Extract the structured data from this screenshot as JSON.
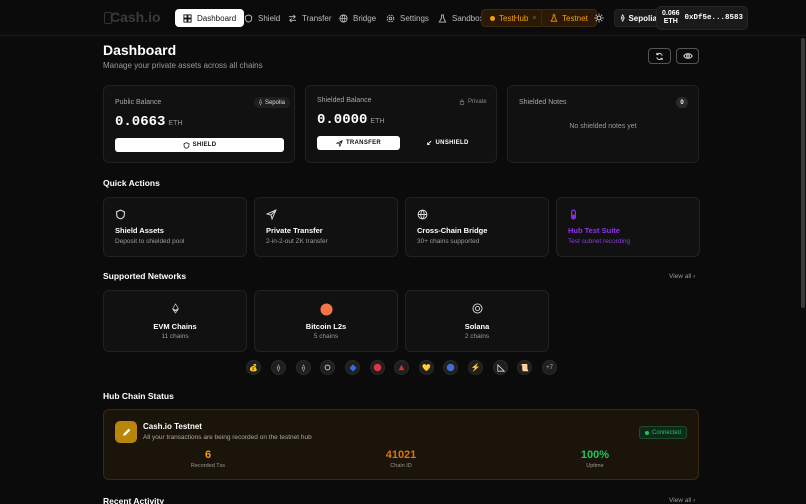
{
  "nav": {
    "brand": "Cash.io",
    "items": [
      "Dashboard",
      "Shield",
      "Transfer",
      "Bridge",
      "Settings",
      "Sandbox"
    ],
    "testhub": "TestHub",
    "testnet": "Testnet",
    "network": "Sepolia",
    "wallet_balance": "0.066",
    "wallet_unit": "ETH",
    "wallet_address": "0xDf5e...8583"
  },
  "header": {
    "title": "Dashboard",
    "subtitle": "Manage your private assets across all chains"
  },
  "public_balance": {
    "label": "Public Balance",
    "chip": "Sepolia",
    "value": "0.0663",
    "unit": "ETH",
    "button": "SHIELD"
  },
  "shielded_balance": {
    "label": "Shielded Balance",
    "chip": "Private",
    "value": "0.0000",
    "unit": "ETH",
    "transfer": "TRANSFER",
    "unshield": "UNSHIELD"
  },
  "shielded_notes": {
    "label": "Shielded Notes",
    "count": "0",
    "empty": "No shielded notes yet"
  },
  "quick_actions": {
    "title": "Quick Actions",
    "items": [
      {
        "title": "Shield Assets",
        "sub": "Deposit to shielded pool"
      },
      {
        "title": "Private Transfer",
        "sub": "2-in-2-out ZK transfer"
      },
      {
        "title": "Cross-Chain Bridge",
        "sub": "30+ chains supported"
      },
      {
        "title": "Hub Test Suite",
        "sub": "Test subnet recording"
      }
    ]
  },
  "networks": {
    "title": "Supported Networks",
    "view_all": "View all",
    "items": [
      {
        "name": "EVM Chains",
        "count": "11 chains"
      },
      {
        "name": "Bitcoin L2s",
        "count": "5 chains"
      },
      {
        "name": "Solana",
        "count": "2 chains"
      }
    ],
    "more": "+7"
  },
  "hub": {
    "title": "Hub Chain Status",
    "name": "Cash.io Testnet",
    "sub": "All your transactions are being recorded on the testnet hub",
    "status": "Connected",
    "stats": [
      {
        "value": "6",
        "label": "Recorded Txs",
        "color": "#f59e0b"
      },
      {
        "value": "41021",
        "label": "Chain ID",
        "color": "#d97706"
      },
      {
        "value": "100%",
        "label": "Uptime",
        "color": "#22c55e"
      }
    ]
  },
  "recent": {
    "title": "Recent Activity",
    "view_all": "View all"
  },
  "colors": {
    "accent_orange": "#f59e0b",
    "accent_purple": "#9333ea",
    "success": "#22c55e"
  }
}
